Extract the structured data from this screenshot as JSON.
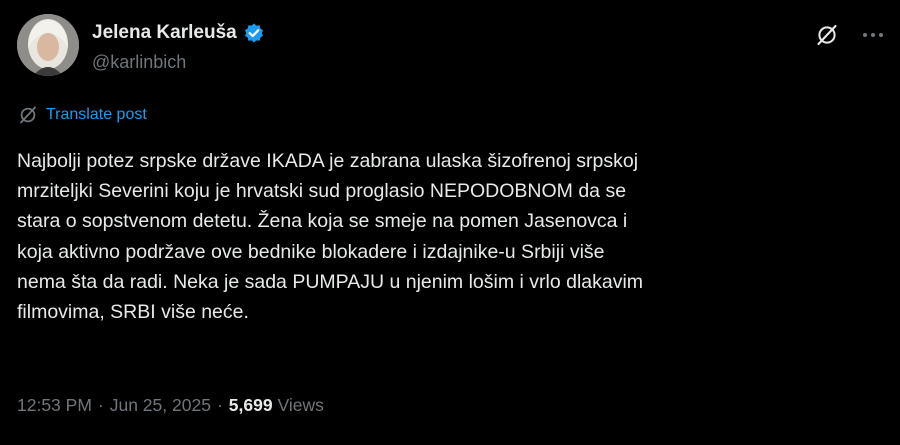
{
  "author": {
    "display_name": "Jelena Karleuša",
    "handle": "@karlinbich",
    "verified": true,
    "avatar_icon": "profile-photo"
  },
  "actions": {
    "grok_icon": "grok-icon",
    "more_icon": "more-options-icon"
  },
  "translate": {
    "label": "Translate post",
    "icon": "grok-translate-icon"
  },
  "post": {
    "lines": [
      "Najbolji potez srpske države IKADA je zabrana ulaska šizofrenoj srpskoj",
      "mrziteljki Severini koju je hrvatski sud proglasio NEPODOBNOM da se",
      "stara o sopstvenom detetu. Žena koja se smeje na pomen Jasenovca i",
      "koja aktivno podržave ove bednike blokadere i izdajnike-u Srbiji više",
      "nema šta da radi. Neka je sada PUMPAJU u njenim lošim i vrlo dlakavim",
      "filmovima, SRBI više neće."
    ]
  },
  "meta": {
    "time": "12:53 PM",
    "separator": "·",
    "date": "Jun 25, 2025",
    "views_count": "5,699",
    "views_label": "Views"
  },
  "colors": {
    "background": "#000000",
    "text_primary": "#e7e9ea",
    "text_secondary": "#71767b",
    "link": "#1d9bf0",
    "verified_badge": "#1d9bf0"
  }
}
